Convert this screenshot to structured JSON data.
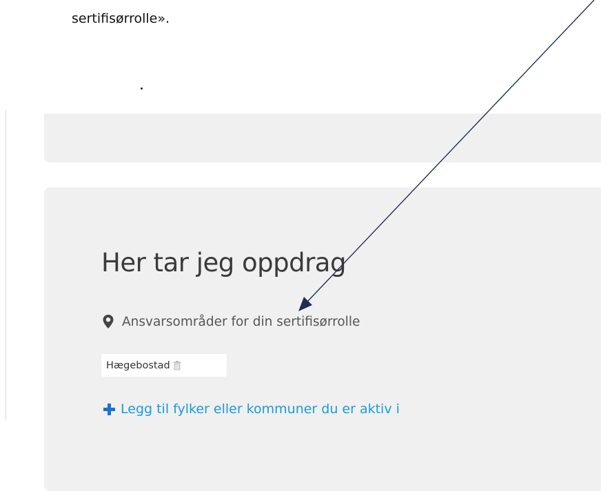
{
  "document": {
    "text_line": "sertifisørrolle»."
  },
  "panel": {
    "heading": "Her tar jeg oppdrag",
    "subtitle": "Ansvarsområder for din sertifisørrolle",
    "subtitle_icon": "map-marker-icon",
    "tags": [
      {
        "label": "Hægebostad",
        "icon": "trash-icon"
      }
    ],
    "add_link": {
      "label": "Legg til fylker eller kommuner du er aktiv i",
      "icon": "plus-icon",
      "color": "#1a9bd7"
    },
    "background_color": "#f0f0f0"
  },
  "annotation": {
    "arrow_color": "#1f2d57",
    "icon": "annotation-arrow"
  }
}
